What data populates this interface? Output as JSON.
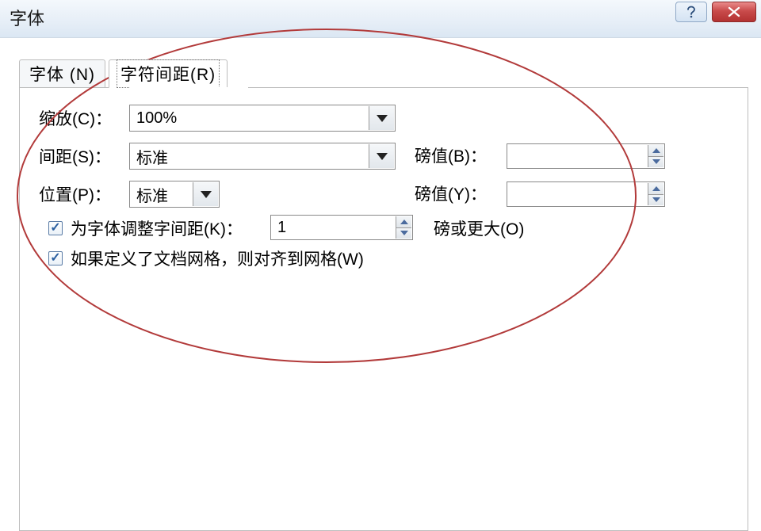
{
  "window": {
    "title": "字体"
  },
  "tabs": {
    "font": "字体 (N)",
    "spacing": "字符间距(R)"
  },
  "form": {
    "scale_label": "缩放(C)：",
    "scale_value": "100%",
    "spacing_label": "间距(S)：",
    "spacing_value": "标准",
    "spacing_pt_label": "磅值(B)：",
    "spacing_pt_value": "",
    "position_label": "位置(P)：",
    "position_value": "标准",
    "position_pt_label": "磅值(Y)：",
    "position_pt_value": "",
    "kerning_label": "为字体调整字间距(K)：",
    "kerning_value": "1",
    "kerning_tail": "磅或更大(O)",
    "snapgrid_label": "如果定义了文档网格，则对齐到网格(W)"
  }
}
